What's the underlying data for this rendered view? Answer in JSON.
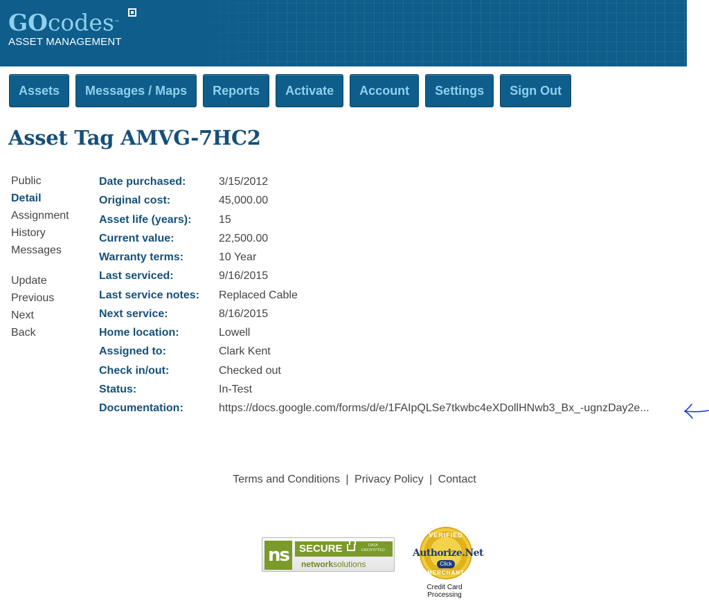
{
  "header": {
    "logo_go": "GO",
    "logo_codes": "codes",
    "logo_tm": "™",
    "logo_subtitle": "ASSET MANAGEMENT"
  },
  "nav": {
    "items": [
      {
        "label": "Assets"
      },
      {
        "label": "Messages / Maps"
      },
      {
        "label": "Reports"
      },
      {
        "label": "Activate"
      },
      {
        "label": "Account"
      },
      {
        "label": "Settings"
      },
      {
        "label": "Sign Out"
      }
    ]
  },
  "page": {
    "title": "Asset Tag AMVG-7HC2"
  },
  "side_menu": {
    "primary": [
      {
        "label": "Public"
      },
      {
        "label": "Detail",
        "active": true
      },
      {
        "label": "Assignment"
      },
      {
        "label": "History"
      },
      {
        "label": "Messages"
      }
    ],
    "secondary": [
      {
        "label": "Update"
      },
      {
        "label": "Previous"
      },
      {
        "label": "Next"
      },
      {
        "label": "Back"
      }
    ]
  },
  "details": {
    "rows": [
      {
        "label": "Date purchased:",
        "value": "3/15/2012"
      },
      {
        "label": "Original cost:",
        "value": "45,000.00"
      },
      {
        "label": "Asset life (years):",
        "value": "15"
      },
      {
        "label": "Current value:",
        "value": "22,500.00"
      },
      {
        "label": "Warranty terms:",
        "value": "10 Year"
      },
      {
        "label": "Last serviced:",
        "value": "9/16/2015"
      },
      {
        "label": "Last service notes:",
        "value": "Replaced Cable"
      },
      {
        "label": "Next service:",
        "value": "8/16/2015"
      },
      {
        "label": "Home location:",
        "value": "Lowell"
      },
      {
        "label": "Assigned to:",
        "value": "Clark Kent"
      },
      {
        "label": "Check in/out:",
        "value": "Checked out"
      },
      {
        "label": "Status:",
        "value": "In-Test"
      },
      {
        "label": "Documentation:",
        "value": "https://docs.google.com/forms/d/e/1FAIpQLSe7tkwbc4eXDollHNwb3_Bx_-ugnzDay2e..."
      }
    ]
  },
  "footer": {
    "terms": "Terms and Conditions",
    "privacy": "Privacy Policy",
    "contact": "Contact",
    "separator": "|"
  },
  "badges": {
    "ns_logo": "ns",
    "ns_secure": "SECURE",
    "ns_data_line1": "DATA",
    "ns_data_line2": "ENCRYPTED",
    "ns_name_bold": "network",
    "ns_name_rest": "solutions",
    "auth_verified": "VERIFIED",
    "auth_name": "Authorize.Net",
    "auth_click": "Click",
    "auth_merchant": "MERCHANT",
    "auth_caption_1": "Credit Card",
    "auth_caption_2": "Processing"
  },
  "colors": {
    "brand_blue": "#0e5d8a",
    "nav_text": "#8fd0ef",
    "label_blue": "#15507a",
    "annotation_arrow": "#1a3ccf"
  },
  "icons": {
    "annotation": "left-arrow-icon"
  }
}
